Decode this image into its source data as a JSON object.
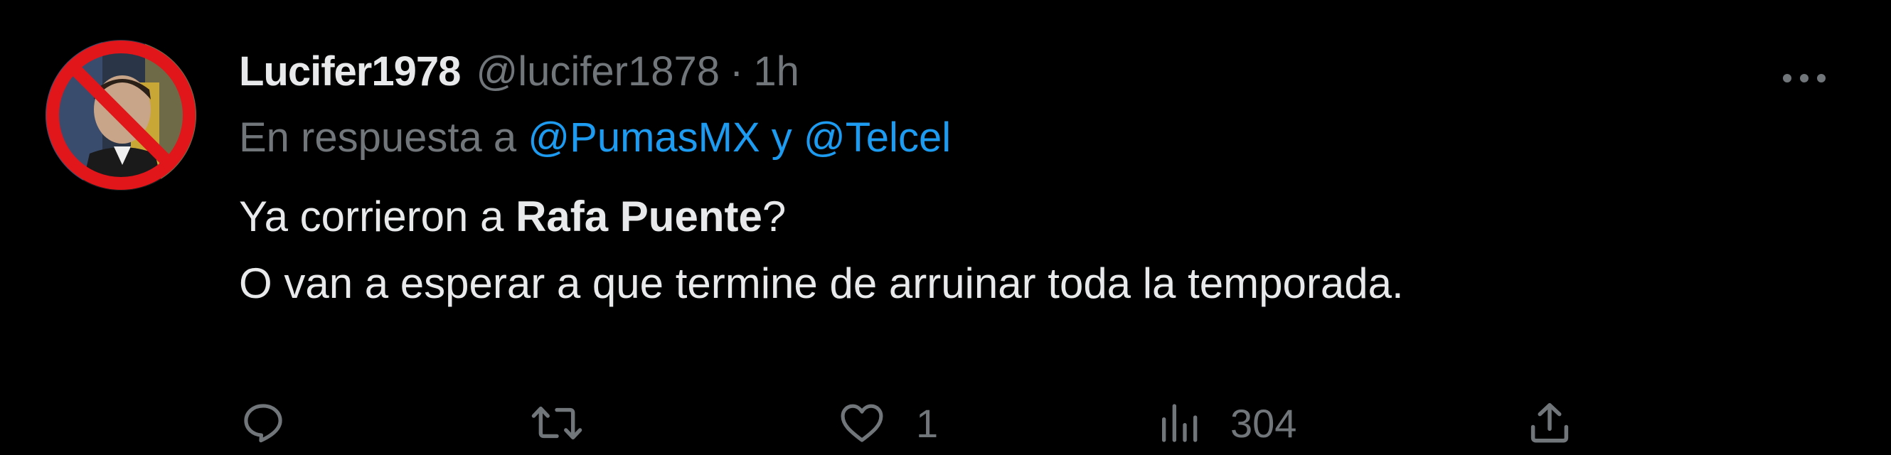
{
  "tweet": {
    "author": {
      "display_name": "Lucifer1978",
      "handle": "@lucifer1878",
      "separator": "·",
      "time": "1h"
    },
    "reply_to": {
      "prefix": "En respuesta a",
      "mention_1": "@PumasMX",
      "conjunction": "y",
      "mention_2": "@Telcel"
    },
    "text": {
      "line1_start": "Ya corrieron a ",
      "line1_bold": "Rafa Puente",
      "line1_end": "?",
      "line2": "O van a esperar a que termine de arruinar toda la temporada."
    },
    "actions": {
      "reply_count": "",
      "retweet_count": "",
      "like_count": "1",
      "views_count": "304"
    }
  },
  "colors": {
    "background": "#000000",
    "text_primary": "#e7e9ea",
    "text_secondary": "#71767b",
    "accent": "#1d9bf0",
    "avatar_ban": "#e0161b"
  },
  "icons": {
    "more": "more-horizontal-icon",
    "reply": "reply-bubble-icon",
    "retweet": "retweet-arrows-icon",
    "like": "heart-icon",
    "views": "bar-chart-icon",
    "share": "share-upload-icon"
  }
}
